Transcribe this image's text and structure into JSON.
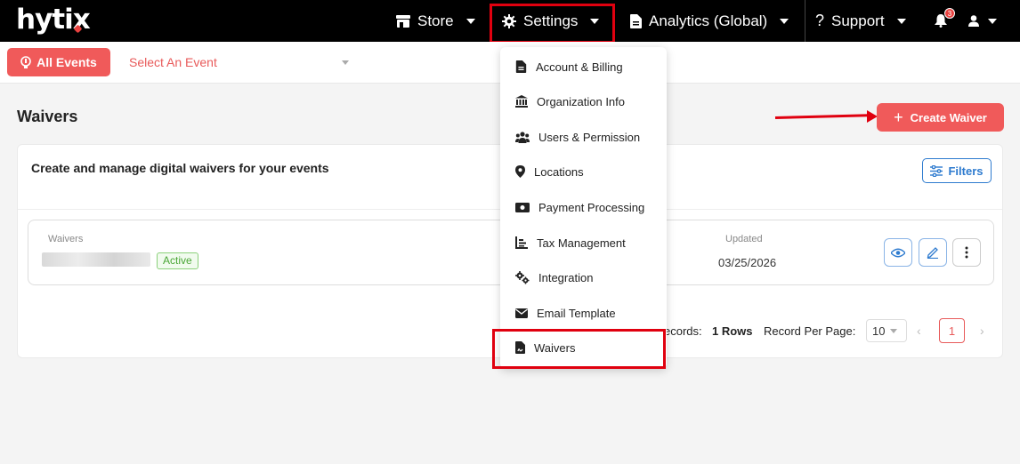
{
  "brand": {
    "logo_text": "hytix",
    "accent": "#f05a5a",
    "highlight": "#e0000f"
  },
  "nav": {
    "store": "Store",
    "settings": "Settings",
    "analytics": "Analytics (Global)",
    "support": "Support",
    "notification_count": "3"
  },
  "subbar": {
    "all_events": "All Events",
    "select_event": "Select An Event"
  },
  "page": {
    "title": "Waivers",
    "create_button": "Create Waiver"
  },
  "card": {
    "description": "Create and manage digital waivers for your events",
    "filters_button": "Filters",
    "row": {
      "col_label": "Waivers",
      "status_badge": "Active",
      "updated_label": "Updated",
      "updated_value": "03/25/2026"
    },
    "pager": {
      "records_label": "ecords:",
      "records_value": "1 Rows",
      "per_page_label": "Record Per Page:",
      "per_page_value": "10",
      "current_page": "1"
    }
  },
  "settings_menu": {
    "items": [
      {
        "label": "Account & Billing",
        "icon": "document-icon"
      },
      {
        "label": "Organization Info",
        "icon": "bank-icon"
      },
      {
        "label": "Users & Permission",
        "icon": "users-icon"
      },
      {
        "label": "Locations",
        "icon": "map-pin-icon"
      },
      {
        "label": "Payment Processing",
        "icon": "money-icon"
      },
      {
        "label": "Tax Management",
        "icon": "chart-icon"
      },
      {
        "label": "Integration",
        "icon": "cogs-icon"
      },
      {
        "label": "Email Template",
        "icon": "envelope-icon"
      },
      {
        "label": "Waivers",
        "icon": "file-signature-icon"
      }
    ]
  }
}
